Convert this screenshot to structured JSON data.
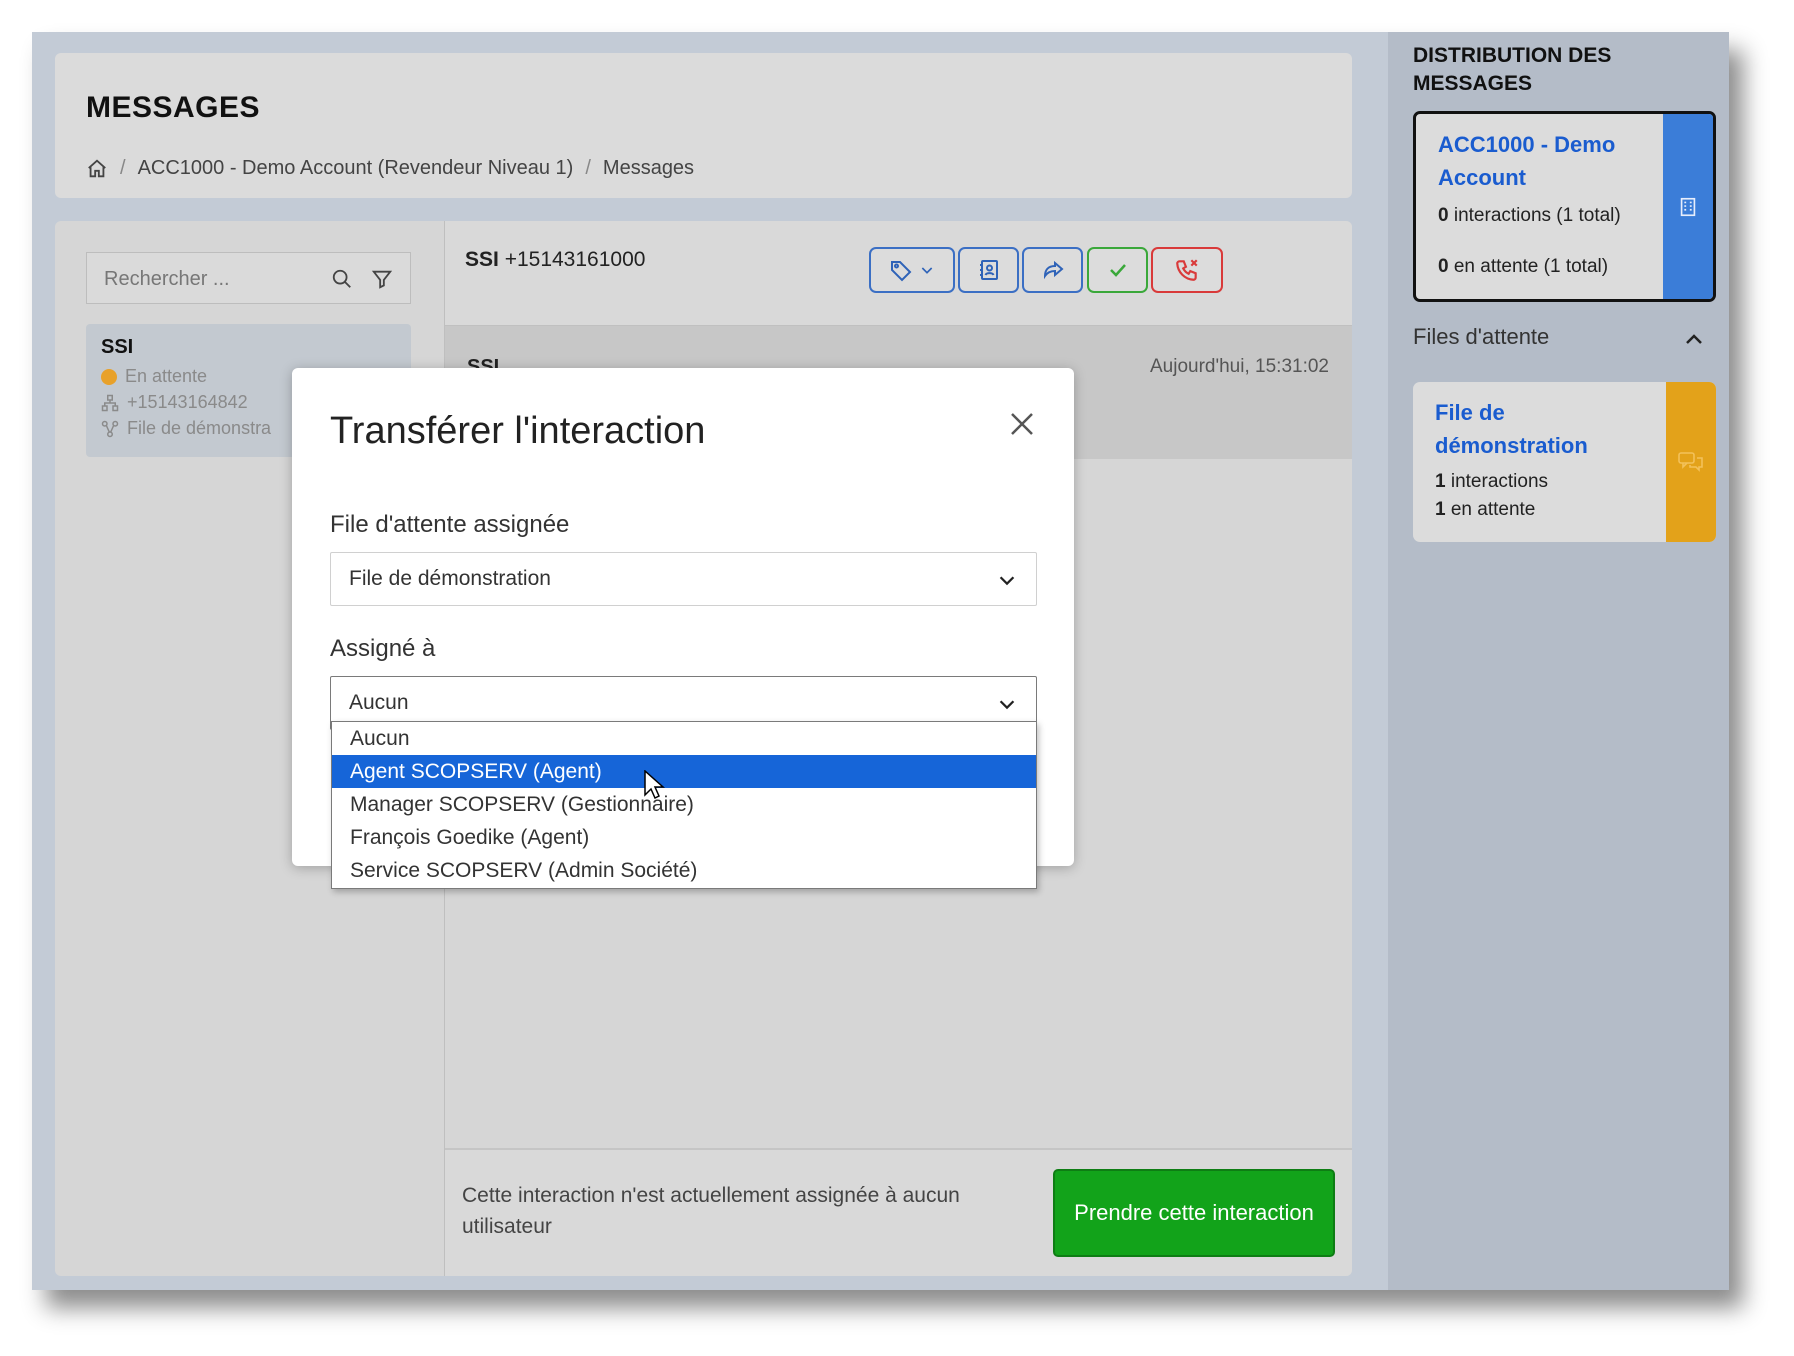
{
  "header": {
    "title": "MESSAGES",
    "breadcrumb": [
      "ACC1000 - Demo Account (Revendeur Niveau 1)",
      "Messages"
    ]
  },
  "search": {
    "placeholder": "Rechercher ..."
  },
  "conversation_list": [
    {
      "name": "SSI",
      "status": "En attente",
      "phone": "+15143164842",
      "queue": "File de démonstra"
    }
  ],
  "conversation": {
    "contact": "SSI",
    "number": "+15143161000",
    "message_sender": "SSI",
    "message_time": "Aujourd'hui, 15:31:02",
    "footer_text": "Cette interaction n'est actuellement assignée à aucun utilisateur",
    "take_button": "Prendre cette interaction"
  },
  "sidebar": {
    "distribution_title": "DISTRIBUTION DES MESSAGES",
    "account": {
      "name": "ACC1000 - Demo Account",
      "interactions_count": "0",
      "interactions_text": "interactions (1 total)",
      "waiting_count": "0",
      "waiting_text": "en attente (1 total)"
    },
    "queues_label": "Files d'attente",
    "queue": {
      "name": "File de démonstration",
      "interactions_count": "1",
      "interactions_text": "interactions",
      "waiting_count": "1",
      "waiting_text": "en attente"
    }
  },
  "modal": {
    "title": "Transférer l'interaction",
    "queue_label": "File d'attente assignée",
    "queue_value": "File de démonstration",
    "assign_label": "Assigné à",
    "assign_value": "Aucun",
    "options": [
      "Aucun",
      "Agent SCOPSERV (Agent)",
      "Manager SCOPSERV (Gestionnaire)",
      "François Goedike (Agent)",
      "Service SCOPSERV (Admin Société)"
    ],
    "highlighted_option_index": 1
  },
  "colors": {
    "accent_blue": "#1a5ccf",
    "account_strip": "#3b7dd8",
    "queue_strip": "#e3a21a",
    "status_waiting": "#e8a12a",
    "take_button": "#12a31a",
    "selected_option": "#1665d8",
    "hangup_red": "#d93a3a",
    "accept_green": "#3aa83a"
  },
  "icons": {
    "breadcrumb_home": "home-icon",
    "search": "search-icon",
    "filter": "filter-icon",
    "tag": "tag-icon",
    "contact": "contact-card-icon",
    "forward": "forward-icon",
    "accept": "check-icon",
    "hangup": "phone-hangup-icon",
    "account": "building-icon",
    "queue": "chat-bubbles-icon",
    "collapse": "chevron-up-icon",
    "close": "close-icon"
  }
}
